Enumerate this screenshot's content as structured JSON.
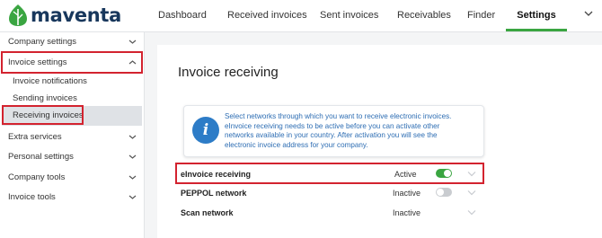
{
  "brand": {
    "name": "maventa",
    "logo_color": "#3aa541",
    "text_color": "#18375c"
  },
  "top_nav": {
    "tabs": [
      {
        "label": "Dashboard"
      },
      {
        "label": "Received invoices"
      },
      {
        "label": "Sent invoices"
      },
      {
        "label": "Receivables"
      },
      {
        "label": "Finder"
      },
      {
        "label": "Settings",
        "active": true
      }
    ],
    "accent_color": "#3aa541",
    "more_icon": "chevron-down-icon"
  },
  "sidebar": {
    "items": [
      {
        "label": "Company settings",
        "icon": "chevron-down-icon"
      },
      {
        "label": "Invoice settings",
        "icon": "chevron-up-icon",
        "expanded": true,
        "highlighted": true
      },
      {
        "label": "Invoice notifications"
      },
      {
        "label": "Sending invoices"
      },
      {
        "label": "Receiving invoices",
        "selected": true,
        "highlighted": true
      },
      {
        "label": "Extra services",
        "icon": "chevron-down-icon"
      },
      {
        "label": "Personal settings",
        "icon": "chevron-down-icon"
      },
      {
        "label": "Company tools",
        "icon": "chevron-down-icon"
      },
      {
        "label": "Invoice tools",
        "icon": "chevron-down-icon"
      }
    ]
  },
  "main": {
    "title": "Invoice receiving",
    "info": {
      "icon": "info-icon",
      "text_lines": [
        "Select networks through which you want to receive electronic invoices.",
        "eInvoice receiving needs to be active before you can activate other",
        "networks available in your country. After activation you will see the",
        "electronic invoice address for your company."
      ],
      "color": "#2d7cc7"
    },
    "networks": [
      {
        "name": "eInvoice receiving",
        "status": "Active",
        "toggle": "on",
        "highlighted": true
      },
      {
        "name": "PEPPOL network",
        "status": "Inactive",
        "toggle": "off"
      },
      {
        "name": "Scan network",
        "status": "Inactive",
        "toggle": null
      }
    ],
    "highlight_color": "#d3232f"
  }
}
